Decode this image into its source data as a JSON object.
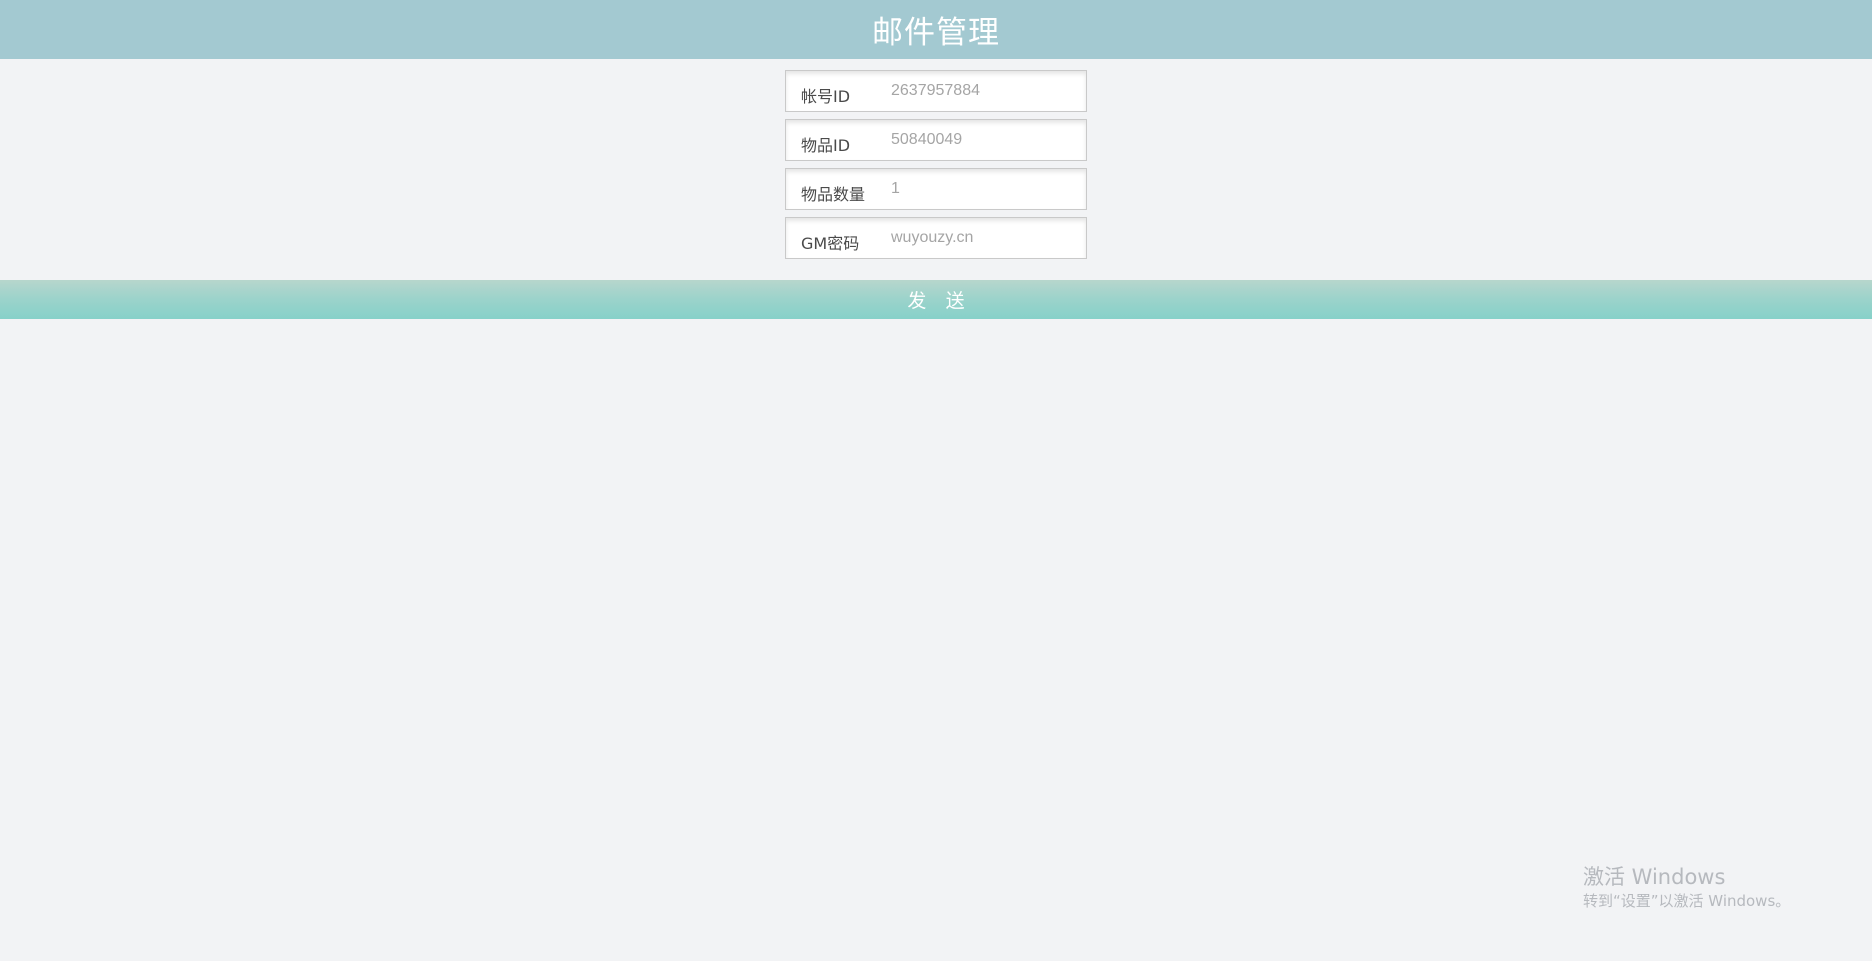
{
  "header": {
    "title": "邮件管理"
  },
  "form": {
    "fields": [
      {
        "label": "帐号ID",
        "placeholder": "2637957884"
      },
      {
        "label": "物品ID",
        "placeholder": "50840049"
      },
      {
        "label": "物品数量",
        "placeholder": "1"
      },
      {
        "label": "GM密码",
        "placeholder": "wuyouzy.cn"
      }
    ],
    "submit_label": "发 送"
  },
  "watermark": {
    "line1": "激活 Windows",
    "line2": "转到“设置”以激活 Windows。"
  },
  "colors": {
    "header_bg": "#a3c9d1",
    "button_gradient_top": "#b7d6cc",
    "button_gradient_bottom": "#86d1c9",
    "page_bg": "#f2f3f5"
  }
}
